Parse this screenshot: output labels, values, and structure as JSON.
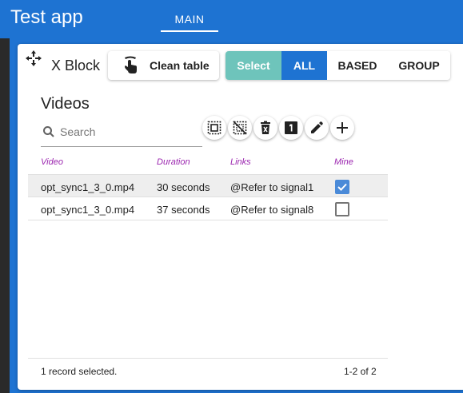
{
  "app": {
    "title": "Test app",
    "tab_main": "MAIN"
  },
  "block": {
    "title": "X Block",
    "clean_table_label": "Clean table",
    "segments": {
      "select": "Select",
      "all": "ALL",
      "based": "BASED",
      "group": "GROUP"
    }
  },
  "videos": {
    "title": "Videos",
    "search_placeholder": "Search",
    "toolbar_icons": [
      "select-all-icon",
      "deselect-all-icon",
      "delete-icon",
      "numbered-one-icon",
      "edit-pencil-icon",
      "add-icon"
    ],
    "columns": [
      "Video",
      "Duration",
      "Links",
      "Mine"
    ],
    "rows": [
      {
        "video": "opt_sync1_3_0.mp4",
        "duration": "30 seconds",
        "links": "@Refer to signal1",
        "mine": true,
        "selected": true
      },
      {
        "video": "opt_sync1_3_0.mp4",
        "duration": "37 seconds",
        "links": "@Refer to signal8",
        "mine": false,
        "selected": false
      }
    ],
    "footer_selected": "1 record selected.",
    "footer_range": "1-2 of 2"
  },
  "colors": {
    "primary": "#1e73d2",
    "accent": "#6ec4bb",
    "header_text": "#9c27b0"
  }
}
